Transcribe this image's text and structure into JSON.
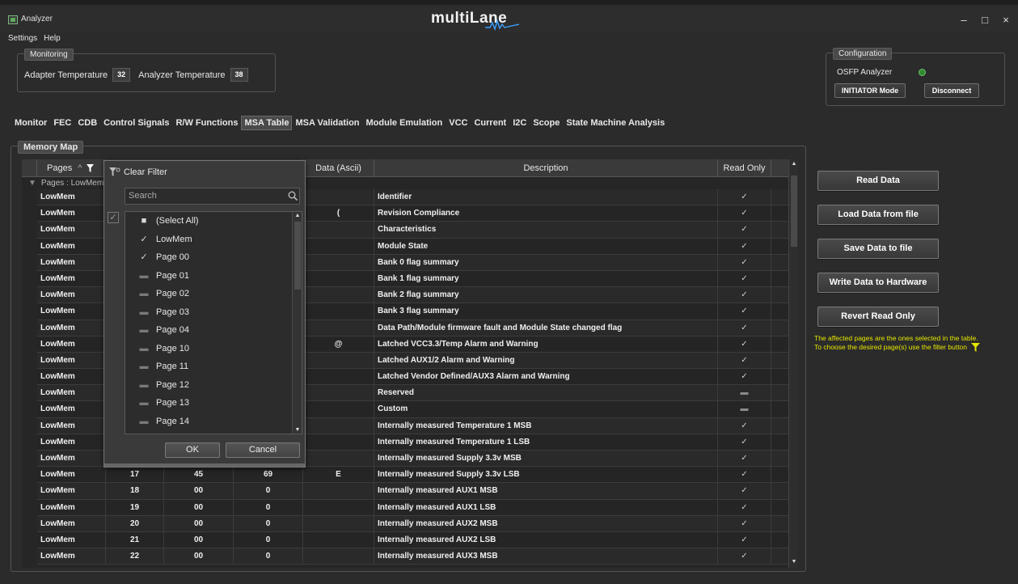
{
  "window": {
    "app_title": "Analyzer",
    "brand": "multiLane",
    "controls": {
      "minimize": "–",
      "maximize": "□",
      "close": "×"
    }
  },
  "menu": {
    "items": [
      "Settings",
      "Help"
    ]
  },
  "monitoring": {
    "title": "Monitoring",
    "adapter_label": "Adapter Temperature",
    "adapter_value": "32",
    "analyzer_label": "Analyzer Temperature",
    "analyzer_value": "38"
  },
  "configuration": {
    "title": "Configuration",
    "device": "OSFP Analyzer",
    "status_color": "#2e8b2e",
    "mode_button": "INITIATOR Mode",
    "disconnect_button": "Disconnect"
  },
  "tabs": {
    "items": [
      "Monitor",
      "FEC",
      "CDB",
      "Control Signals",
      "R/W Functions",
      "MSA Table",
      "MSA Validation",
      "Module Emulation",
      "VCC",
      "Current",
      "I2C",
      "Scope",
      "State Machine Analysis"
    ],
    "active": "MSA Table"
  },
  "memory_map": {
    "title": "Memory Map",
    "columns": {
      "pages": "Pages",
      "ascii": "Data (Ascii)",
      "description": "Description",
      "read_only": "Read Only"
    },
    "group_label": "Pages : LowMem",
    "rows": [
      {
        "page": "LowMem",
        "addr": "",
        "hex": "",
        "dec": "",
        "ascii": "",
        "desc": "Identifier",
        "ro": true
      },
      {
        "page": "LowMem",
        "addr": "",
        "hex": "",
        "dec": "",
        "ascii": "(",
        "desc": "Revision Compliance",
        "ro": true
      },
      {
        "page": "LowMem",
        "addr": "",
        "hex": "",
        "dec": "",
        "ascii": "",
        "desc": "Characteristics",
        "ro": true
      },
      {
        "page": "LowMem",
        "addr": "",
        "hex": "",
        "dec": "",
        "ascii": "",
        "desc": "Module State",
        "ro": true
      },
      {
        "page": "LowMem",
        "addr": "",
        "hex": "",
        "dec": "",
        "ascii": "",
        "desc": "Bank 0 flag summary",
        "ro": true
      },
      {
        "page": "LowMem",
        "addr": "",
        "hex": "",
        "dec": "",
        "ascii": "",
        "desc": "Bank 1 flag summary",
        "ro": true
      },
      {
        "page": "LowMem",
        "addr": "",
        "hex": "",
        "dec": "",
        "ascii": "",
        "desc": "Bank 2 flag summary",
        "ro": true
      },
      {
        "page": "LowMem",
        "addr": "",
        "hex": "",
        "dec": "",
        "ascii": "",
        "desc": "Bank 3 flag summary",
        "ro": true
      },
      {
        "page": "LowMem",
        "addr": "",
        "hex": "",
        "dec": "",
        "ascii": "",
        "desc": "Data Path/Module firmware fault and Module State changed flag",
        "ro": true
      },
      {
        "page": "LowMem",
        "addr": "",
        "hex": "",
        "dec": "",
        "ascii": "@",
        "desc": "Latched VCC3.3/Temp Alarm and Warning",
        "ro": true
      },
      {
        "page": "LowMem",
        "addr": "",
        "hex": "",
        "dec": "",
        "ascii": "",
        "desc": "Latched AUX1/2 Alarm and Warning",
        "ro": true
      },
      {
        "page": "LowMem",
        "addr": "",
        "hex": "",
        "dec": "",
        "ascii": "",
        "desc": "Latched Vendor Defined/AUX3 Alarm and Warning",
        "ro": true
      },
      {
        "page": "LowMem",
        "addr": "",
        "hex": "",
        "dec": "",
        "ascii": "",
        "desc": "Reserved",
        "ro": false
      },
      {
        "page": "LowMem",
        "addr": "",
        "hex": "",
        "dec": "",
        "ascii": "",
        "desc": "Custom",
        "ro": false
      },
      {
        "page": "LowMem",
        "addr": "",
        "hex": "",
        "dec": "",
        "ascii": "",
        "desc": "Internally measured Temperature 1 MSB",
        "ro": true
      },
      {
        "page": "LowMem",
        "addr": "",
        "hex": "",
        "dec": "",
        "ascii": "",
        "desc": "Internally measured Temperature 1 LSB",
        "ro": true
      },
      {
        "page": "LowMem",
        "addr": "",
        "hex": "",
        "dec": "",
        "ascii": "",
        "desc": "Internally measured Supply 3.3v MSB",
        "ro": true
      },
      {
        "page": "LowMem",
        "addr": "17",
        "hex": "45",
        "dec": "69",
        "ascii": "E",
        "desc": "Internally measured Supply 3.3v LSB",
        "ro": true
      },
      {
        "page": "LowMem",
        "addr": "18",
        "hex": "00",
        "dec": "0",
        "ascii": "",
        "desc": "Internally measured AUX1 MSB",
        "ro": true
      },
      {
        "page": "LowMem",
        "addr": "19",
        "hex": "00",
        "dec": "0",
        "ascii": "",
        "desc": "Internally measured AUX1 LSB",
        "ro": true
      },
      {
        "page": "LowMem",
        "addr": "20",
        "hex": "00",
        "dec": "0",
        "ascii": "",
        "desc": "Internally measured AUX2 MSB",
        "ro": true
      },
      {
        "page": "LowMem",
        "addr": "21",
        "hex": "00",
        "dec": "0",
        "ascii": "",
        "desc": "Internally measured AUX2 LSB",
        "ro": true
      },
      {
        "page": "LowMem",
        "addr": "22",
        "hex": "00",
        "dec": "0",
        "ascii": "",
        "desc": "Internally measured AUX3 MSB",
        "ro": true
      }
    ]
  },
  "filter_popup": {
    "clear_filter": "Clear Filter",
    "search_placeholder": "Search",
    "items": [
      {
        "label": "(Select All)",
        "state": "partial"
      },
      {
        "label": "LowMem",
        "state": "checked"
      },
      {
        "label": "Page 00",
        "state": "checked"
      },
      {
        "label": "Page 01",
        "state": "unchecked"
      },
      {
        "label": "Page 02",
        "state": "unchecked"
      },
      {
        "label": "Page 03",
        "state": "unchecked"
      },
      {
        "label": "Page 04",
        "state": "unchecked"
      },
      {
        "label": "Page 10",
        "state": "unchecked"
      },
      {
        "label": "Page 11",
        "state": "unchecked"
      },
      {
        "label": "Page 12",
        "state": "unchecked"
      },
      {
        "label": "Page 13",
        "state": "unchecked"
      },
      {
        "label": "Page 14",
        "state": "unchecked"
      }
    ],
    "ok": "OK",
    "cancel": "Cancel"
  },
  "actions": {
    "read": "Read Data",
    "load": "Load Data from file",
    "save": "Save Data to file",
    "write": "Write Data to Hardware",
    "revert": "Revert Read Only",
    "hint_line1": "The affected pages are the ones selected in the table.",
    "hint_line2": "To choose the desired page(s) use the filter button",
    "hint_color": "#e6e600"
  }
}
